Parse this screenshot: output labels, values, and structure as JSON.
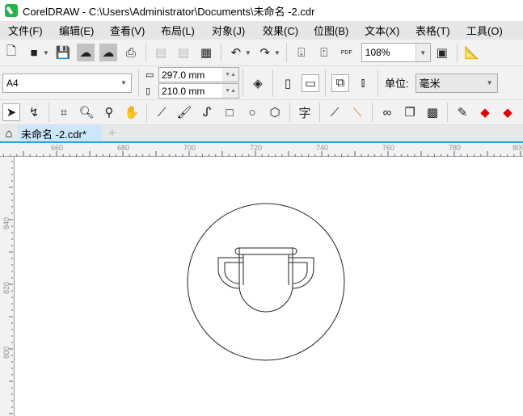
{
  "window": {
    "title": "CorelDRAW - C:\\Users\\Administrator\\Documents\\未命名 -2.cdr"
  },
  "menu": [
    "文件(F)",
    "编辑(E)",
    "查看(V)",
    "布局(L)",
    "对象(J)",
    "效果(C)",
    "位图(B)",
    "文本(X)",
    "表格(T)",
    "工具(O)"
  ],
  "toolbar": {
    "zoom": "108%",
    "pdf_label": "PDF"
  },
  "propbar": {
    "page_size": "A4",
    "width": "297.0 mm",
    "height": "210.0 mm",
    "unit_label": "单位:",
    "unit": "毫米"
  },
  "tabs": {
    "document": "未命名 -2.cdr*",
    "add": "+"
  },
  "ruler": {
    "h": [
      "660",
      "680",
      "700",
      "720",
      "740",
      "760",
      "780",
      "800"
    ],
    "v": [
      "840",
      "820",
      "800"
    ]
  }
}
